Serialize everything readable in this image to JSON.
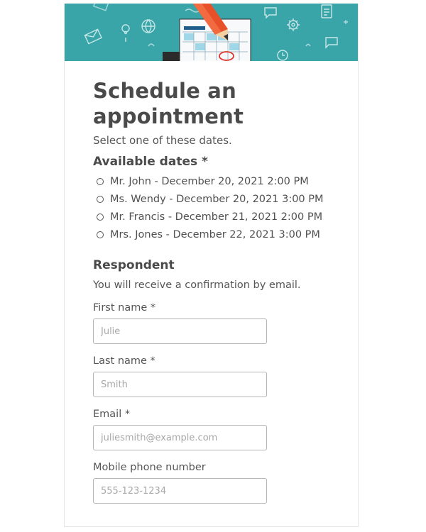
{
  "form": {
    "title": "Schedule an appointment",
    "subtitle": "Select one of these dates."
  },
  "colors": {
    "banner": "#3aa5a8",
    "pencil": "#e8502a",
    "calendar_header": "#1f5d8a"
  },
  "banner_icons": [
    "envelope-icon",
    "location-pin-icon",
    "globe-icon",
    "pencil-icon",
    "calendar-icon",
    "clock-icon",
    "gear-icon",
    "chat-bubble-icon",
    "document-icon"
  ],
  "available_dates": {
    "label": "Available dates *",
    "options": [
      "Mr. John - December 20, 2021 2:00 PM",
      "Ms. Wendy - December 20, 2021 3:00 PM",
      "Mr. Francis - December 21, 2021 2:00 PM",
      "Mrs. Jones - December 22, 2021 3:00 PM"
    ]
  },
  "respondent": {
    "title": "Respondent",
    "description": "You will receive a confirmation by email.",
    "fields": {
      "first_name": {
        "label": "First name *",
        "placeholder": "Julie"
      },
      "last_name": {
        "label": "Last name *",
        "placeholder": "Smith"
      },
      "email": {
        "label": "Email *",
        "placeholder": "juliesmith@example.com"
      },
      "mobile": {
        "label": "Mobile phone number",
        "placeholder": "555-123-1234"
      }
    }
  }
}
